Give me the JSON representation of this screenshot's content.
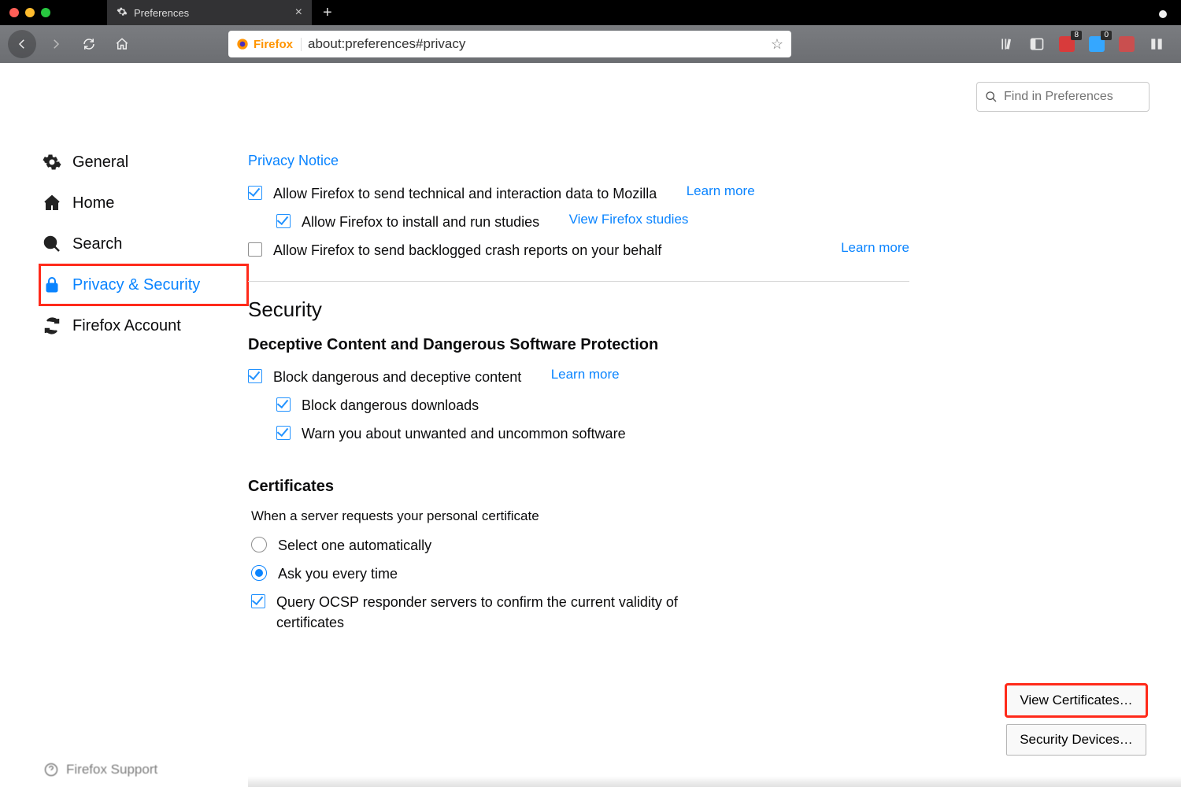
{
  "tab": {
    "title": "Preferences"
  },
  "url": "about:preferences#privacy",
  "brand": "Firefox",
  "search": {
    "placeholder": "Find in Preferences"
  },
  "extBadges": {
    "a": "8",
    "b": "0"
  },
  "sidebar": {
    "items": [
      {
        "label": "General"
      },
      {
        "label": "Home"
      },
      {
        "label": "Search"
      },
      {
        "label": "Privacy & Security"
      },
      {
        "label": "Firefox Account"
      }
    ],
    "support": "Firefox Support"
  },
  "notice": "Privacy Notice",
  "options": {
    "sendData": "Allow Firefox to send technical and interaction data to Mozilla",
    "sendDataLink": "Learn more",
    "studies": "Allow Firefox to install and run studies",
    "studiesLink": "View Firefox studies",
    "crash": "Allow Firefox to send backlogged crash reports on your behalf",
    "crashLink": "Learn more"
  },
  "security": {
    "heading": "Security",
    "sub": "Deceptive Content and Dangerous Software Protection",
    "block": "Block dangerous and deceptive content",
    "blockLink": "Learn more",
    "downloads": "Block dangerous downloads",
    "unwanted": "Warn you about unwanted and uncommon software"
  },
  "certs": {
    "heading": "Certificates",
    "prompt": "When a server requests your personal certificate",
    "auto": "Select one automatically",
    "ask": "Ask you every time",
    "ocsp": "Query OCSP responder servers to confirm the current validity of certificates",
    "viewBtn": "View Certificates…",
    "devicesBtn": "Security Devices…"
  }
}
